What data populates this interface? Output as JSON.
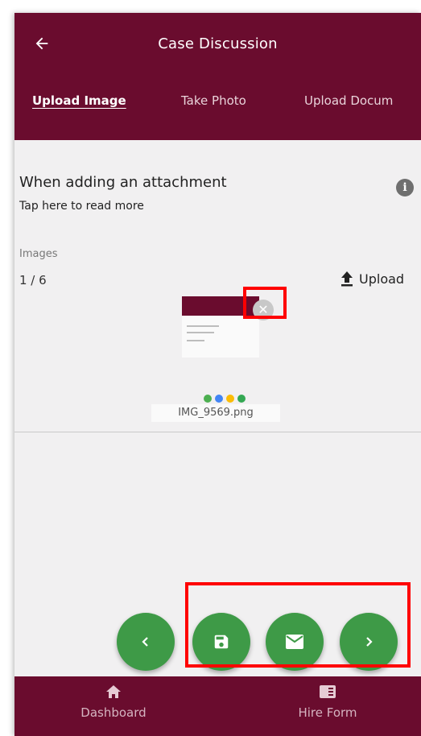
{
  "header": {
    "title": "Case Discussion",
    "back_icon": "arrow-left-icon"
  },
  "tabs": [
    {
      "label": "Upload Image",
      "active": true
    },
    {
      "label": "Take Photo",
      "active": false
    },
    {
      "label": "Upload Docum",
      "active": false
    }
  ],
  "info": {
    "title": "When adding an attachment",
    "subtitle": "Tap here to read more",
    "icon": "info-icon"
  },
  "images": {
    "label": "Images",
    "count": "1 / 6",
    "upload_label": "Upload",
    "file": {
      "name": "IMG_9569.png"
    }
  },
  "fabs": [
    {
      "icon": "chevron-left-icon"
    },
    {
      "icon": "save-icon"
    },
    {
      "icon": "mail-icon"
    },
    {
      "icon": "chevron-right-icon"
    }
  ],
  "bottom_nav": [
    {
      "label": "Dashboard",
      "icon": "home-icon"
    },
    {
      "label": "Hire Form",
      "icon": "form-icon"
    }
  ],
  "colors": {
    "primary": "#6a0c2e",
    "fab": "#3e9a47",
    "highlight": "#ff0000",
    "background": "#f1f0f1"
  }
}
